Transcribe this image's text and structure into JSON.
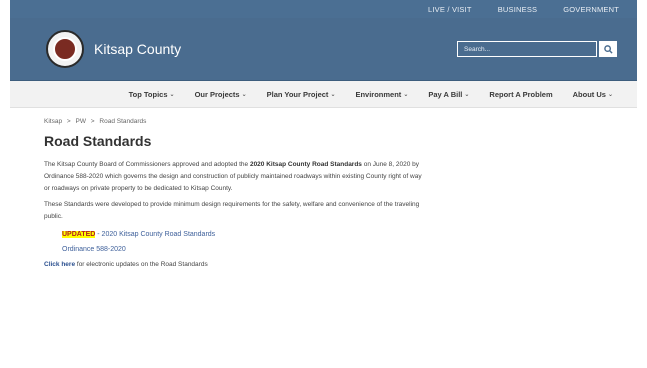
{
  "utility": {
    "items": [
      "LIVE / VISIT",
      "BUSINESS",
      "GOVERNMENT"
    ]
  },
  "header": {
    "brand": "Kitsap County",
    "search_placeholder": "Search..."
  },
  "nav": {
    "items": [
      {
        "label": "Top Topics",
        "caret": "⌄"
      },
      {
        "label": "Our Projects",
        "caret": "⌄"
      },
      {
        "label": "Plan Your Project",
        "caret": "⌄"
      },
      {
        "label": "Environment",
        "caret": "⌄"
      },
      {
        "label": "Pay A Bill",
        "caret": "⌄"
      },
      {
        "label": "Report A Problem",
        "caret": ""
      },
      {
        "label": "About Us",
        "caret": "⌄"
      }
    ]
  },
  "breadcrumb": [
    "Kitsap",
    ">",
    "PW",
    ">",
    "Road Standards"
  ],
  "page": {
    "title": "Road Standards",
    "p1_pre": "The Kitsap County Board of Commissioners approved and adopted the ",
    "p1_bold": "2020 Kitsap County Road Standards",
    "p1_post": " on June 8, 2020 by Ordinance 588-2020 which governs the design and construction of publicly maintained roadways within existing County right of way or roadways on private property to be dedicated to Kitsap County.",
    "p2": "These Standards were developed to provide minimum design requirements for the safety, welfare and convenience of the traveling public.",
    "updated_tag": "UPDATED",
    "updated_link": " - 2020 Kitsap County Road Standards",
    "ordinance_link": "Ordinance 588-2020",
    "click_here": "Click here",
    "click_rest": " for electronic updates on the Road Standards"
  }
}
